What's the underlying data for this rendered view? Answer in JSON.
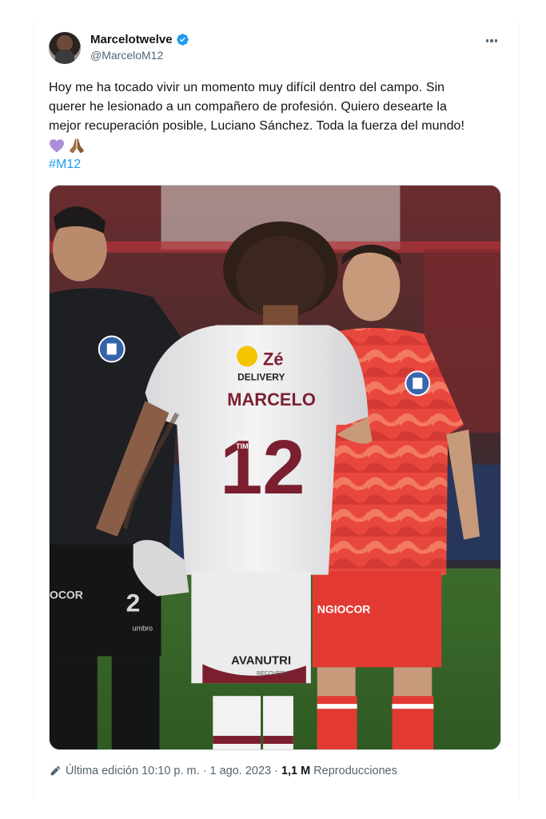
{
  "tweet": {
    "author": {
      "display_name": "Marcelotwelve",
      "handle": "@MarceloM12",
      "verified": true
    },
    "text_lines": [
      "Hoy me ha tocado vivir un momento muy difícil dentro del campo. Sin",
      "querer he lesionado a un compañero de profesión. Quiero desearte la",
      "mejor recuperación posible, Luciano Sánchez. Toda la fuerza del mundo!"
    ],
    "emojis": [
      "purple-heart",
      "folded-hands"
    ],
    "hashtag": "#M12",
    "image": {
      "jersey_sponsor_top": "Zé",
      "jersey_sponsor_sub": "DELIVERY",
      "jersey_name": "MARCELO",
      "jersey_number": "12",
      "shorts_sponsor": "AVANUTRI",
      "shorts_sponsor_sub": "RECOVERY",
      "red_shorts_sponsor": "NGIOCOR",
      "keeper_shorts_text": "OCOR",
      "keeper_number": "2",
      "kit_brand": "umbro",
      "jersey_side_text": "TIM"
    },
    "footer": {
      "edited_label": "Última edición 10:10 p. m.",
      "separator": "·",
      "date": "1 ago. 2023",
      "views_count": "1,1 M",
      "views_label": "Reproducciones"
    }
  },
  "colors": {
    "link": "#1d9bf0",
    "secondary_text": "#536471",
    "verified_badge": "#1d9bf0"
  }
}
